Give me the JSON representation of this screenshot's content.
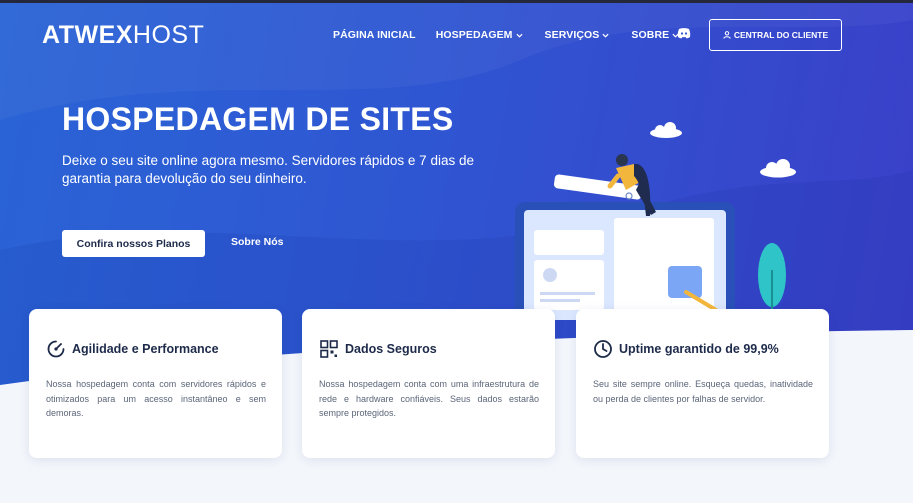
{
  "brand": {
    "logo_bold": "ATWEX",
    "logo_light": "HOST"
  },
  "nav": {
    "items": [
      {
        "label": "PÁGINA INICIAL",
        "has_dropdown": false
      },
      {
        "label": "HOSPEDAGEM",
        "has_dropdown": true
      },
      {
        "label": "SERVIÇOS",
        "has_dropdown": true
      },
      {
        "label": "SOBRE",
        "has_dropdown": true
      }
    ],
    "discord_icon": "discord-icon",
    "client_button": "CENTRAL DO CLIENTE"
  },
  "hero": {
    "title": "HOSPEDAGEM DE SITES",
    "subtitle": "Deixe o seu site online agora mesmo. Servidores rápidos e 7 dias de garantia para devolução do seu dinheiro.",
    "primary_button": "Confira nossos Planos",
    "secondary_link": "Sobre Nós"
  },
  "features": [
    {
      "icon": "speedometer-icon",
      "title": "Agilidade e Performance",
      "text": "Nossa hospedagem conta com servidores rápidos e otimizados para um acesso instantâneo e sem demoras."
    },
    {
      "icon": "grid-icon",
      "title": "Dados Seguros",
      "text": "Nossa hospedagem conta com uma infraestrutura de rede e hardware confiáveis. Seus dados estarão sempre protegidos."
    },
    {
      "icon": "clock-icon",
      "title": "Uptime garantido de 99,9%",
      "text": "Seu site sempre online. Esqueça quedas, inatividade ou perda de clientes por falhas de servidor."
    }
  ],
  "colors": {
    "hero_start": "#2a64d6",
    "hero_end": "#3a3fc8",
    "heading_dark": "#1d2a4a",
    "accent_teal": "#2ec4c8"
  }
}
